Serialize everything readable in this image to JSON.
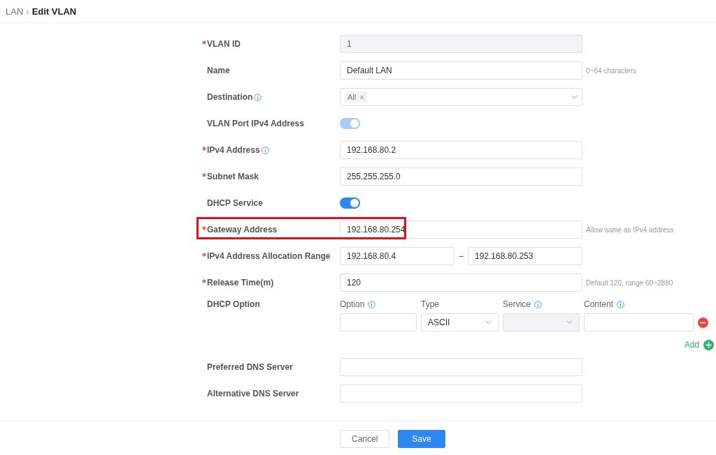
{
  "breadcrumb": {
    "parent": "LAN",
    "separator": "›",
    "current": "Edit VLAN"
  },
  "fields": [
    {
      "kind": "input",
      "label": "VLAN ID",
      "required": true,
      "info": false,
      "value": "1",
      "disabled": true,
      "highlighted": false
    },
    {
      "kind": "input",
      "label": "Name",
      "required": false,
      "info": false,
      "value": "Default LAN",
      "disabled": false,
      "hint": "0~64 characters",
      "highlighted": false
    },
    {
      "kind": "tags",
      "label": "Destination",
      "required": false,
      "info": true,
      "tags": [
        "All"
      ]
    },
    {
      "kind": "toggle",
      "label": "VLAN Port IPv4 Address",
      "required": false,
      "info": false,
      "on": true,
      "disabled": true
    },
    {
      "kind": "input",
      "label": "IPv4 Address",
      "required": true,
      "info": true,
      "value": "192.168.80.2",
      "disabled": false,
      "highlighted": false
    },
    {
      "kind": "input",
      "label": "Subnet Mask",
      "required": true,
      "info": false,
      "value": "255.255.255.0",
      "disabled": false,
      "highlighted": false
    },
    {
      "kind": "toggle",
      "label": "DHCP Service",
      "required": false,
      "info": false,
      "on": true,
      "disabled": false
    },
    {
      "kind": "input",
      "label": "Gateway Address",
      "required": true,
      "info": false,
      "value": "192.168.80.254",
      "disabled": false,
      "hint": "Allow same as IPv4 address",
      "highlighted": true
    },
    {
      "kind": "range",
      "label": "IPv4 Address Allocation Range",
      "required": true,
      "info": false,
      "from": "192.168.80.4",
      "separator": "–",
      "to": "192.168.80.253"
    },
    {
      "kind": "input",
      "label": "Release Time(m)",
      "required": true,
      "info": false,
      "value": "120",
      "disabled": false,
      "hint": "Default 120, range 60~2880",
      "highlighted": false
    },
    {
      "kind": "options",
      "label": "DHCP Option",
      "required": false,
      "info": false,
      "columns": [
        {
          "title": "Option",
          "info": true
        },
        {
          "title": "Type",
          "info": false
        },
        {
          "title": "Service",
          "info": true
        },
        {
          "title": "Content",
          "info": true
        }
      ],
      "rows": [
        {
          "type": "ASCII",
          "service_disabled": true
        }
      ],
      "add": "Add"
    },
    {
      "kind": "input",
      "label": "Preferred DNS Server",
      "required": false,
      "info": false,
      "disabled": false,
      "highlighted": false
    },
    {
      "kind": "input",
      "label": "Alternative DNS Server",
      "required": false,
      "info": false,
      "disabled": false,
      "highlighted": false
    }
  ],
  "buttons": [
    {
      "label": "Cancel",
      "kind": "secondary"
    },
    {
      "label": "Save",
      "kind": "primary"
    }
  ]
}
